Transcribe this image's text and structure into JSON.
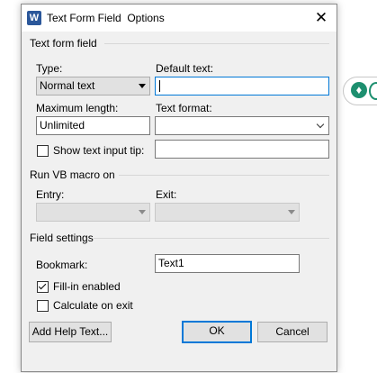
{
  "dialog": {
    "title": "Text Form Field  Options",
    "app_icon_letter": "W",
    "close_glyph": "✕"
  },
  "text_form_field": {
    "group_label": "Text form field",
    "type_label": "Type:",
    "type_value": "Normal text",
    "default_text_label": "Default text:",
    "default_text_value": "",
    "max_length_label": "Maximum length:",
    "max_length_value": "Unlimited",
    "text_format_label": "Text format:",
    "text_format_value": "",
    "show_tip_label": "Show text input tip:",
    "show_tip_checked": false,
    "tip_value": ""
  },
  "run_macro": {
    "group_label": "Run VB macro on",
    "entry_label": "Entry:",
    "entry_value": "",
    "exit_label": "Exit:",
    "exit_value": ""
  },
  "field_settings": {
    "group_label": "Field settings",
    "bookmark_label": "Bookmark:",
    "bookmark_value": "Text1",
    "fill_in_label": "Fill-in enabled",
    "fill_in_checked": true,
    "calc_label": "Calculate on exit",
    "calc_checked": false
  },
  "buttons": {
    "help": "Add Help Text...",
    "ok": "OK",
    "cancel": "Cancel"
  },
  "colors": {
    "focus_accent": "#0078d7",
    "word_brand": "#2b579a",
    "background_app_accent": "#1d8f6f"
  }
}
